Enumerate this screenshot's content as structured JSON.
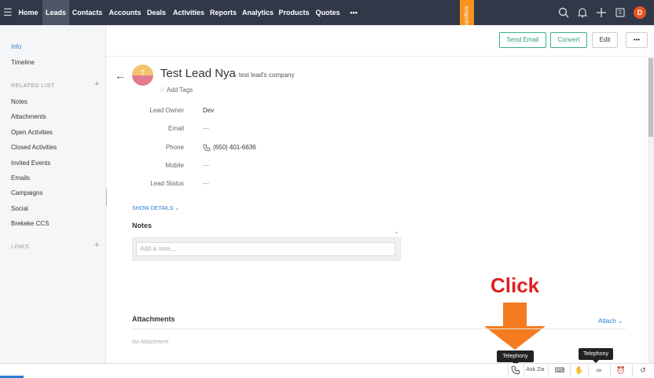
{
  "topnav": {
    "items": [
      "Home",
      "Leads",
      "Contacts",
      "Accounts",
      "Deals",
      "Activities",
      "Reports",
      "Analytics",
      "Products",
      "Quotes"
    ],
    "more": "•••",
    "avatar_initial": "D",
    "sandbox_label": "Sandbox"
  },
  "sidebar": {
    "info": "Info",
    "timeline": "Timeline",
    "related_list_heading": "RELATED LIST",
    "related": [
      "Notes",
      "Attachments",
      "Open Activities",
      "Closed Activities",
      "Invited Events",
      "Emails",
      "Campaigns",
      "Social",
      "Brekeke CCS"
    ],
    "links_heading": "LINKS",
    "plus": "+"
  },
  "actions": {
    "send_email": "Send Email",
    "convert": "Convert",
    "edit": "Edit",
    "more": "•••"
  },
  "lead": {
    "avatar_initial": "T",
    "name": "Test Lead Nya",
    "company": "- test lead's company",
    "add_tags": "Add Tags",
    "fields": [
      {
        "label": "Lead Owner",
        "value": "Dev"
      },
      {
        "label": "Email",
        "value": "—"
      },
      {
        "label": "Phone",
        "value": "(650) 401-6636"
      },
      {
        "label": "Mobile",
        "value": "—"
      },
      {
        "label": "Lead Status",
        "value": "—"
      }
    ],
    "show_details": "SHOW DETAILS"
  },
  "notes": {
    "title": "Notes",
    "placeholder": "Add a note..."
  },
  "annotation": {
    "click": "Click",
    "arrow_color": "#f47b20"
  },
  "attachments": {
    "title": "Attachments",
    "attach_link": "Attach",
    "empty": "No Attachment"
  },
  "tooltips": {
    "telephony_1": "Telephony",
    "telephony_2": "Telephony"
  },
  "bottombar": {
    "ask_zia": "Ask Zia"
  },
  "colors": {
    "nav_bg": "#313949",
    "accent": "#2b7cd3",
    "convert_green": "#3cae8f",
    "click_red": "#e02020",
    "sandbox_orange": "#f7931e"
  }
}
